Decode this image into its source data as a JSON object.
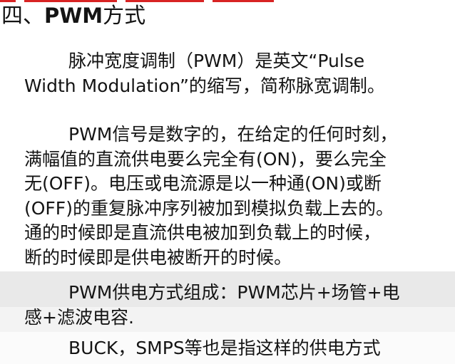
{
  "section": {
    "number": "四、",
    "tag": "PWM",
    "word": "方式"
  },
  "paragraphs": [
    {
      "lines": [
        "脉冲宽度调制（PWM）是英文“Pulse",
        "Width Modulation”的缩写，简称脉宽调制。"
      ]
    },
    {
      "lines": [
        "PWM信号是数字的，在给定的任何时刻，",
        "满幅值的直流供电要么完全有(ON)，要么完全",
        "无(OFF)。电压或电流源是以一种通(ON)或断",
        "(OFF)的重复脉冲序列被加到模拟负载上去的。",
        "通的时候即是直流供电被加到负载上的时候，",
        "断的时候即是供电被断开的时候。"
      ]
    },
    {
      "lines": [
        "PWM供电方式组成：PWM芯片+场管+电",
        "感+滤波电容."
      ]
    },
    {
      "lines": [
        "BUCK，SMPS等也是指这样的供电方式"
      ]
    }
  ],
  "colors": {
    "text": "#141414",
    "background": "#ffffff",
    "top_strip": "#d82323",
    "band_1": "#e9e9e9",
    "band_2": "#f3f3f3",
    "band_3": "#fbfbfb"
  }
}
